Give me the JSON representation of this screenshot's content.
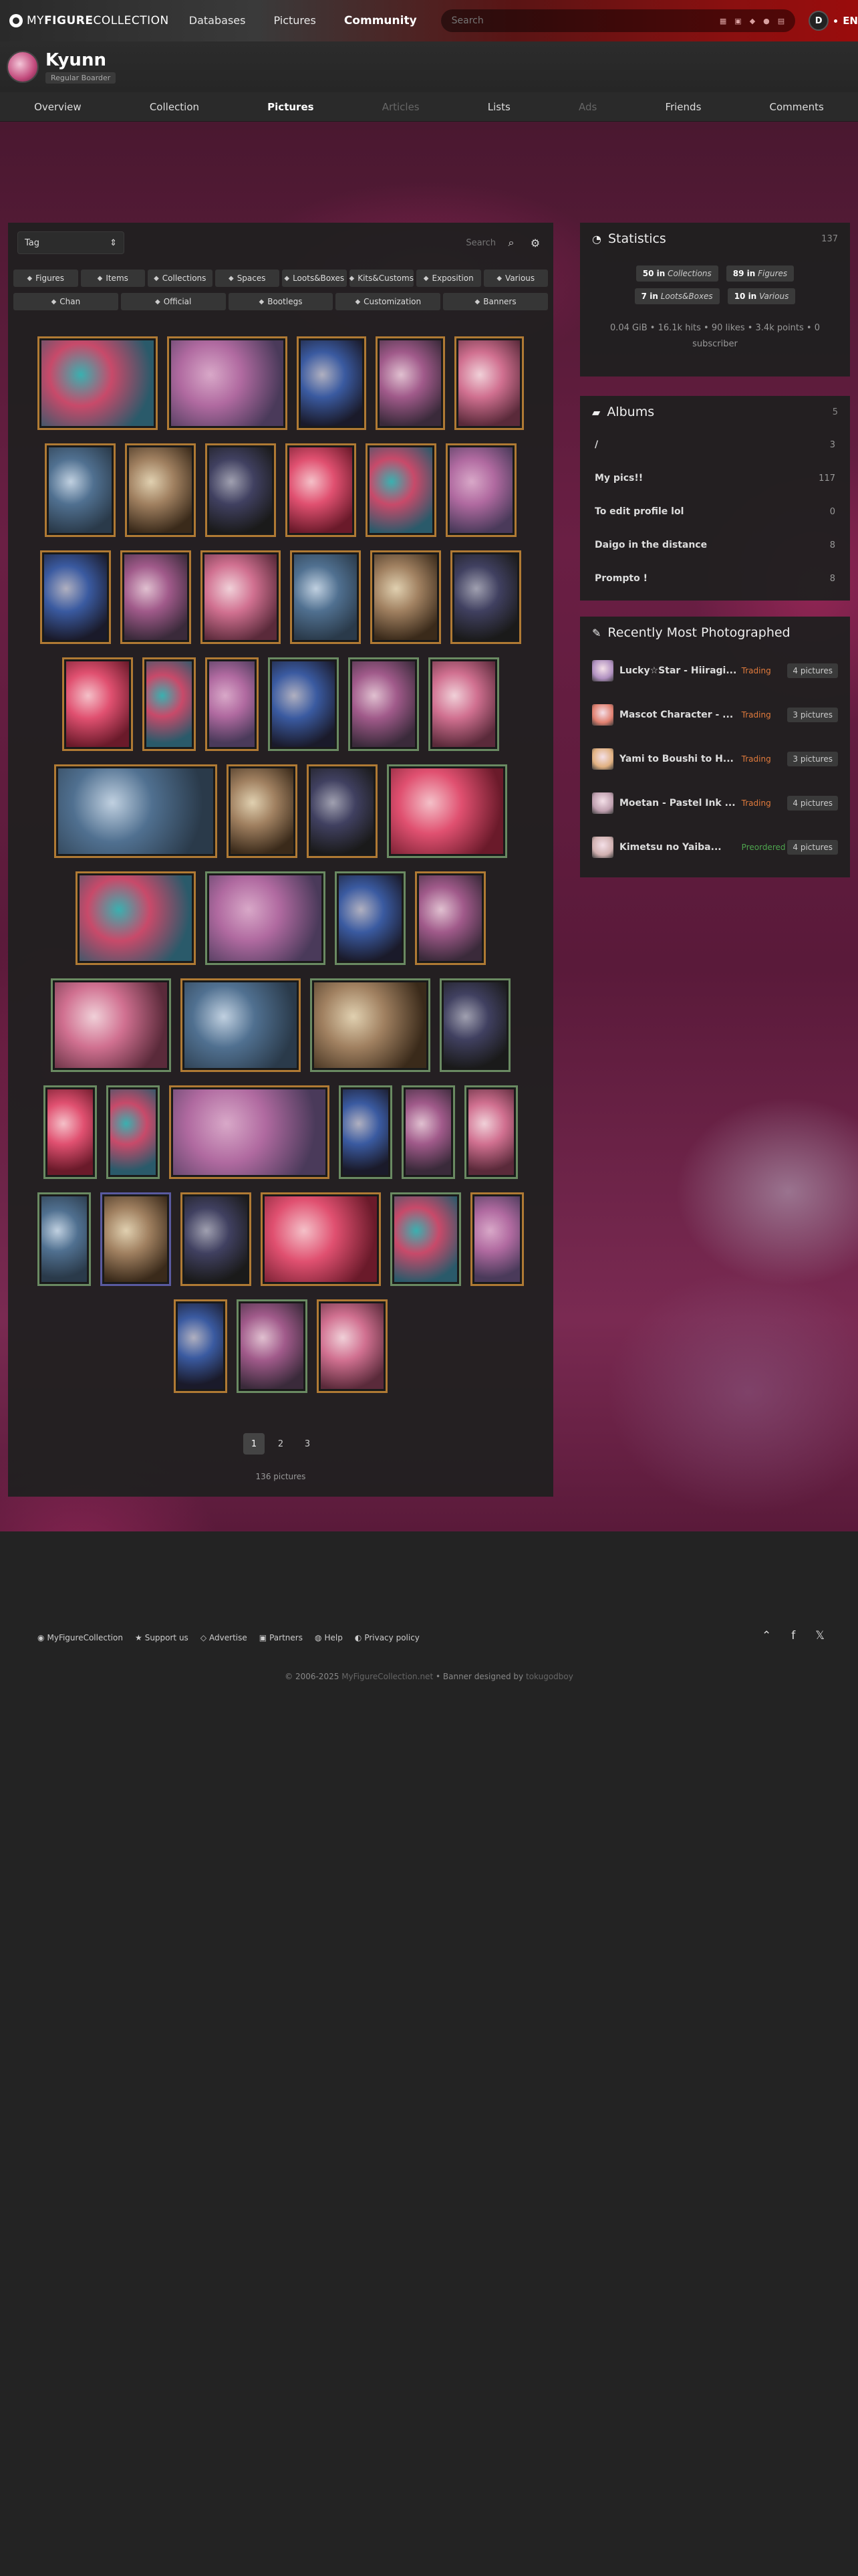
{
  "topbar": {
    "logo_thin1": "MY",
    "logo_bold": "FIGURE",
    "logo_thin2": "COLLECTION",
    "nav": [
      "Databases",
      "Pictures",
      "Community"
    ],
    "search_placeholder": "Search",
    "user_initial": "D",
    "lang": "EN"
  },
  "profile": {
    "name": "Kyunn",
    "rank": "Regular Boarder"
  },
  "tabs": [
    "Overview",
    "Collection",
    "Pictures",
    "Articles",
    "Lists",
    "Ads",
    "Friends",
    "Comments"
  ],
  "filters": {
    "tag_label": "Tag",
    "search_placeholder": "Search",
    "chips_row1": [
      "Figures",
      "Items",
      "Collections",
      "Spaces",
      "Loots&Boxes",
      "Kits&Customs",
      "Exposition",
      "Various"
    ],
    "chips_row2": [
      "Chan",
      "Official",
      "Bootlegs",
      "Customization",
      "Banners"
    ]
  },
  "pagination": {
    "pages": [
      "1",
      "2",
      "3"
    ],
    "count": "136 pictures"
  },
  "statistics": {
    "title": "Statistics",
    "count": "137",
    "pills": [
      {
        "num": "50 in",
        "cat": "Collections"
      },
      {
        "num": "89 in",
        "cat": "Figures"
      },
      {
        "num": "7 in",
        "cat": "Loots&Boxes"
      },
      {
        "num": "10 in",
        "cat": "Various"
      }
    ],
    "summary": "0.04 GiB • 16.1k hits • 90 likes • 3.4k points • 0 subscriber"
  },
  "albums": {
    "title": "Albums",
    "count": "5",
    "items": [
      {
        "name": "/",
        "count": "3"
      },
      {
        "name": "My pics!!",
        "count": "117"
      },
      {
        "name": "To edit profile lol",
        "count": "0"
      },
      {
        "name": "Daigo in the distance",
        "count": "8"
      },
      {
        "name": "Prompto !",
        "count": "8"
      }
    ]
  },
  "recent": {
    "title": "Recently Most Photographed",
    "items": [
      {
        "name": "Lucky☆Star - Hiiragi...",
        "status": "Trading",
        "pics": "4 pictures"
      },
      {
        "name": "Mascot Character - ...",
        "status": "Trading",
        "pics": "3 pictures"
      },
      {
        "name": "Yami to Boushi to H...",
        "status": "Trading",
        "pics": "3 pictures"
      },
      {
        "name": "Moetan - Pastel Ink ...",
        "status": "Trading",
        "pics": "4 pictures"
      },
      {
        "name": "Kimetsu no Yaiba...",
        "status": "Preordered",
        "pics": "4 pictures"
      }
    ]
  },
  "footer": {
    "links": [
      "MyFigureCollection",
      "Support us",
      "Advertise",
      "Partners",
      "Help",
      "Privacy policy"
    ],
    "copyright_pre": "© 2006-2025",
    "copyright_site": "MyFigureCollection.net",
    "copyright_mid": "• Banner designed by",
    "copyright_designer": "tokugodboy"
  },
  "colors": {
    "accent": "#9a0c0c",
    "trading": "#e07a3c",
    "preordered": "#4ea54e",
    "thumb_border_orange": "#b07a34",
    "thumb_border_green": "#6a8a62"
  }
}
